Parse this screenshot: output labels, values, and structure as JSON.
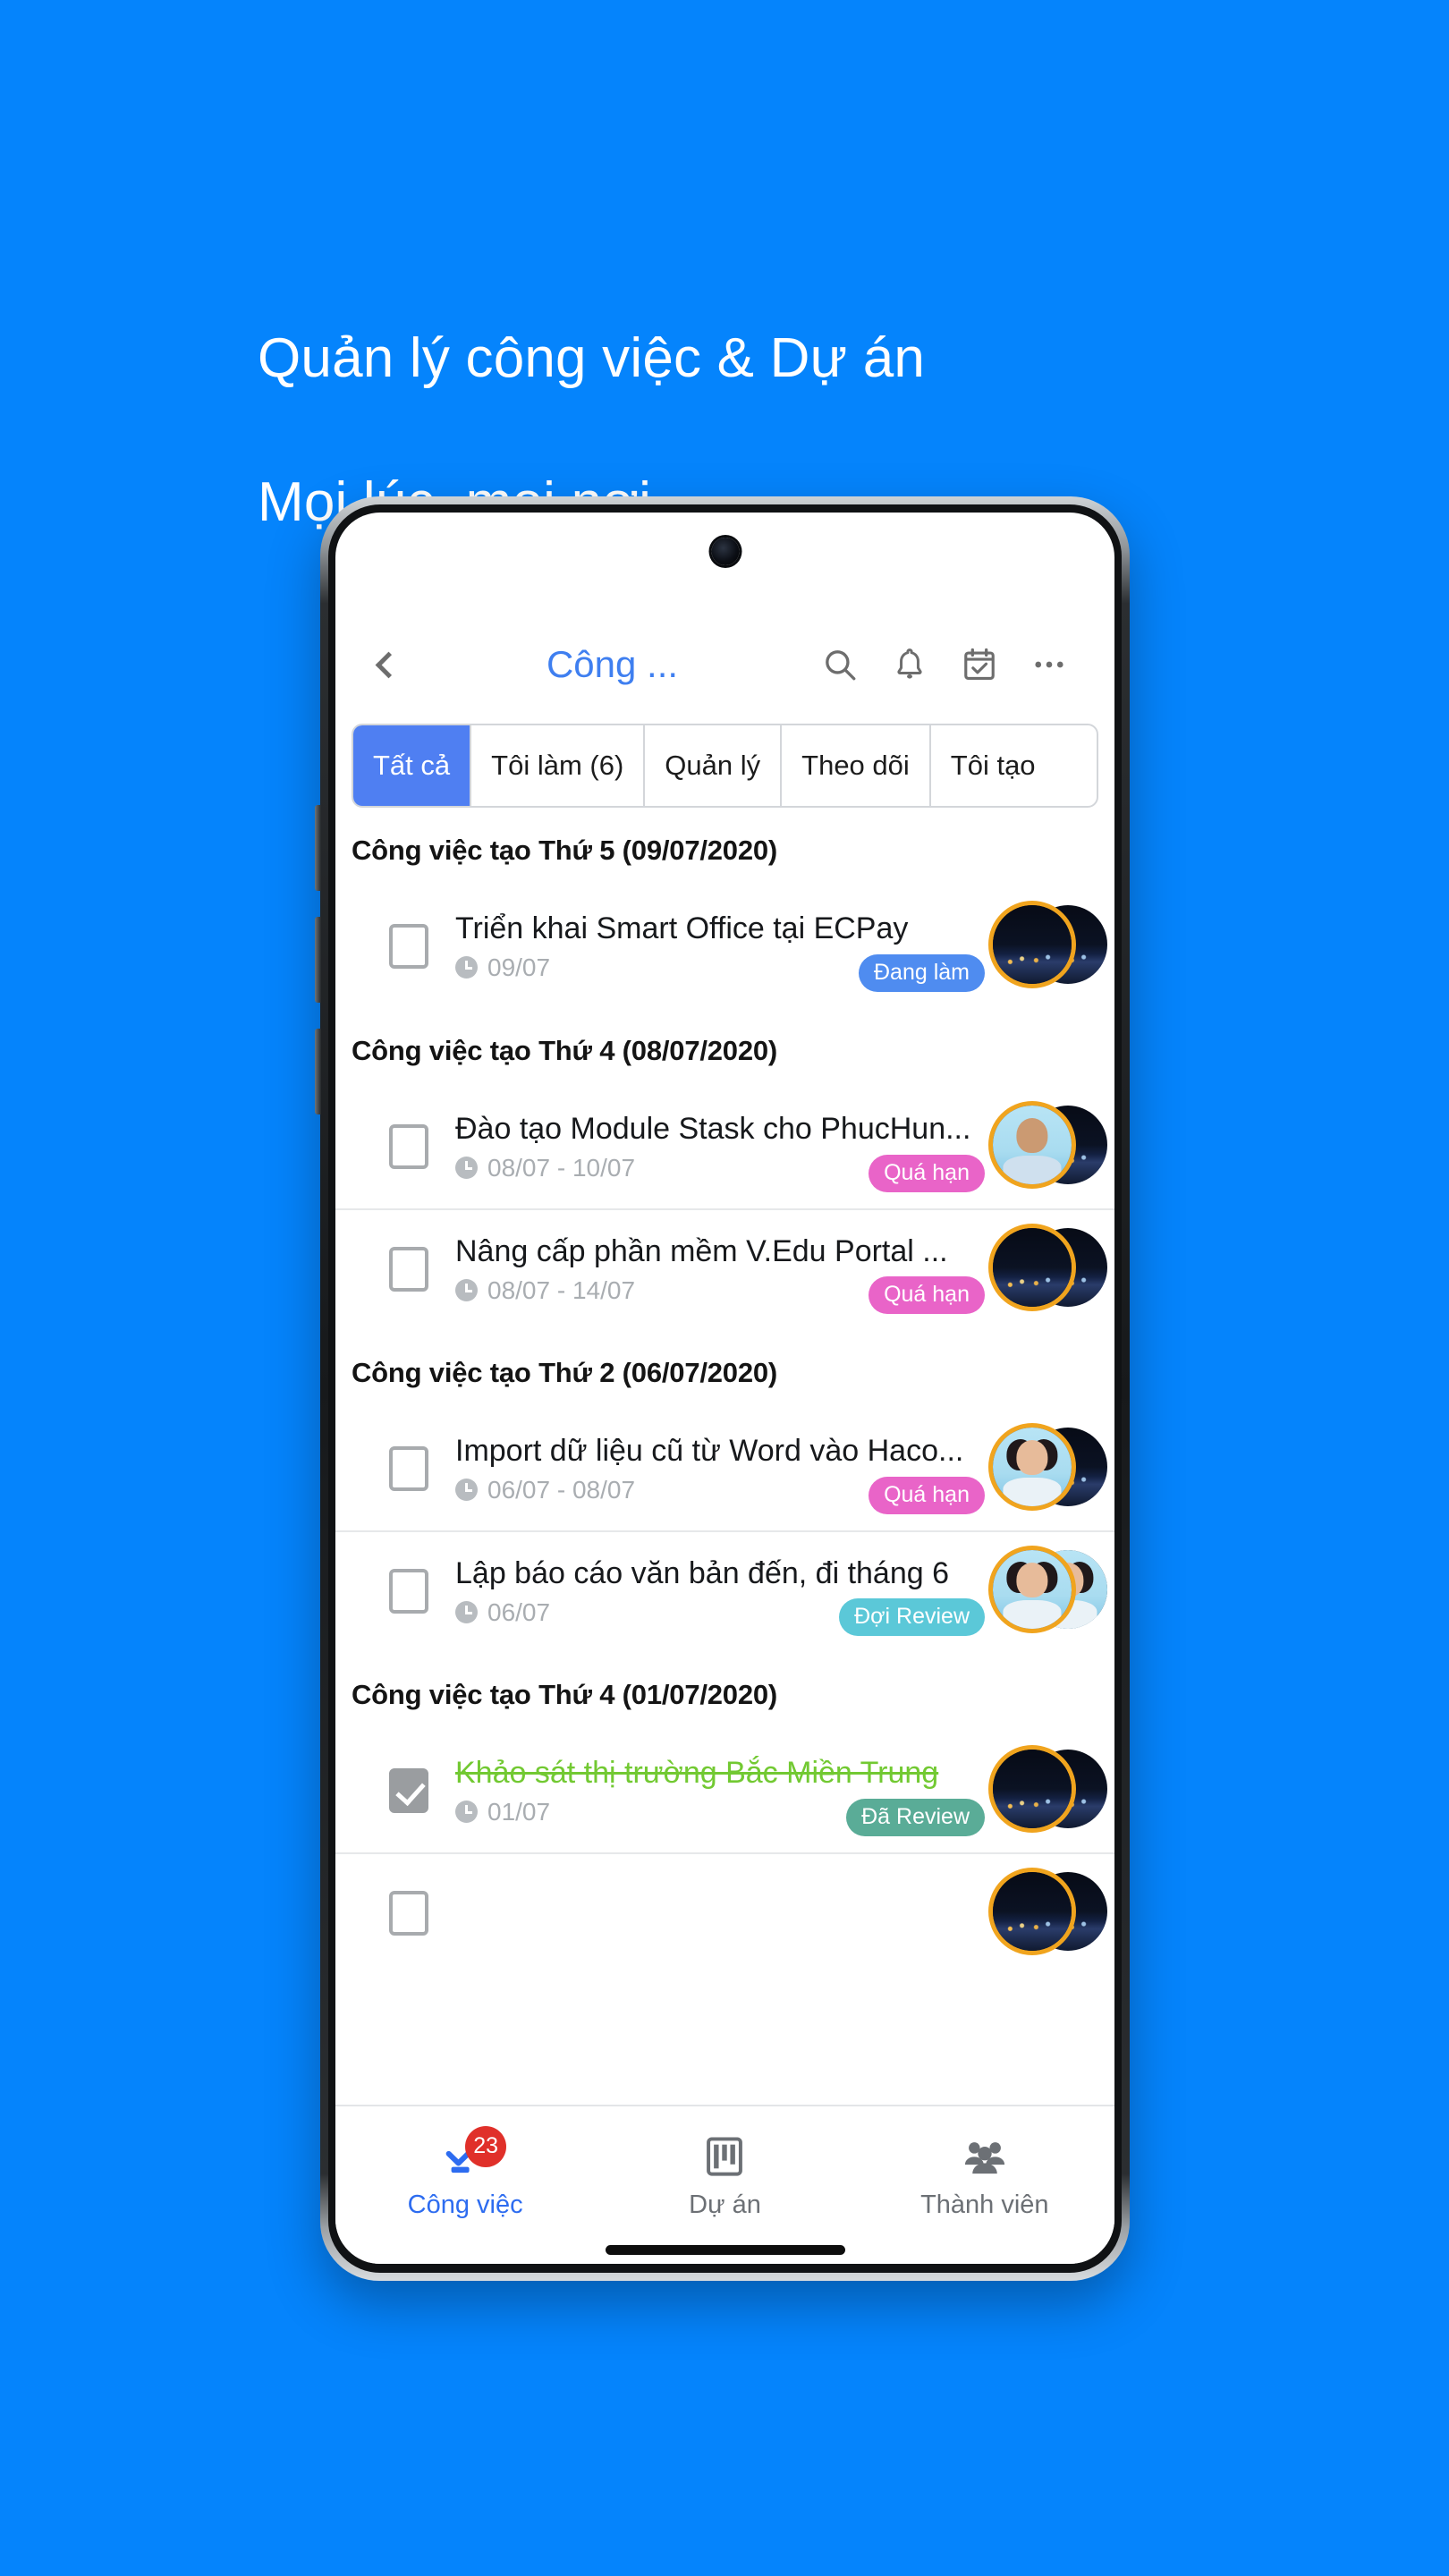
{
  "promo": {
    "headline_line1": "Quản lý công việc & Dự án",
    "headline_line2": "Mọi lúc, mọi nơi",
    "background_color": "#0584fc",
    "text_color": "#ffffff"
  },
  "appbar": {
    "title": "Công ...",
    "back_icon": "chevron-left-icon",
    "icons": [
      "search-icon",
      "bell-icon",
      "calendar-check-icon",
      "more-options-icon"
    ],
    "title_color": "#3f7ff0"
  },
  "tabs": [
    {
      "label": "Tất cả",
      "active": true
    },
    {
      "label": "Tôi làm (6)",
      "active": false
    },
    {
      "label": "Quản lý",
      "active": false
    },
    {
      "label": "Theo dõi",
      "active": false
    },
    {
      "label": "Tôi tạo",
      "active": false
    }
  ],
  "groups": [
    {
      "header": "Công việc tạo Thứ 5 (09/07/2020)",
      "tasks": [
        {
          "title": "Triển khai Smart Office tại ECPay",
          "date": "09/07",
          "badge": "Đang làm",
          "badge_color": "#4f8cf0",
          "checked": false,
          "avatar_front": "city",
          "avatar_back": "city"
        }
      ]
    },
    {
      "header": "Công việc tạo Thứ 4 (08/07/2020)",
      "tasks": [
        {
          "title": "Đào tạo Module Stask cho PhucHun...",
          "date": "08/07  - 10/07",
          "badge": "Quá hạn",
          "badge_color": "#e964c8",
          "checked": false,
          "avatar_front": "male",
          "avatar_back": "city"
        },
        {
          "title": "Nâng cấp phần mềm V.Edu Portal ...",
          "date": "08/07  - 14/07",
          "badge": "Quá hạn",
          "badge_color": "#e964c8",
          "checked": false,
          "avatar_front": "city",
          "avatar_back": "city"
        }
      ]
    },
    {
      "header": "Công việc tạo Thứ 2 (06/07/2020)",
      "tasks": [
        {
          "title": "Import dữ liệu cũ từ Word vào Haco...",
          "date": "06/07  - 08/07",
          "badge": "Quá hạn",
          "badge_color": "#e964c8",
          "checked": false,
          "avatar_front": "female",
          "avatar_back": "city"
        },
        {
          "title": "Lập báo cáo văn bản đến, đi tháng 6",
          "date": "06/07",
          "badge": "Đợi Review",
          "badge_color": "#5bc8d8",
          "checked": false,
          "avatar_front": "female",
          "avatar_back": "female"
        }
      ]
    },
    {
      "header": "Công việc tạo Thứ 4 (01/07/2020)",
      "tasks": [
        {
          "title": "Khảo sát thị trường Bắc Miền Trung",
          "date": "01/07",
          "badge": "Đã Review",
          "badge_color": "#5aac97",
          "checked": true,
          "done": true,
          "avatar_front": "city",
          "avatar_back": "city"
        }
      ]
    }
  ],
  "fab": {
    "icon": "playlist-add-icon",
    "color": "#4f80ef"
  },
  "bottom_nav": [
    {
      "label": "Công việc",
      "icon": "check-task-icon",
      "badge": "23",
      "active": true
    },
    {
      "label": "Dự án",
      "icon": "kanban-board-icon",
      "badge": "",
      "active": false
    },
    {
      "label": "Thành viên",
      "icon": "people-group-icon",
      "badge": "",
      "active": false
    }
  ]
}
